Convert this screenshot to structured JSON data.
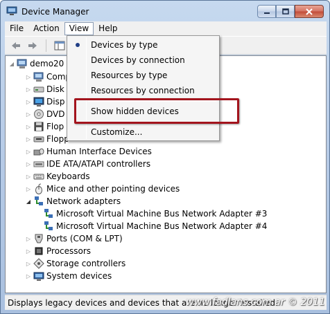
{
  "window": {
    "title": "Device Manager"
  },
  "menubar": {
    "items": [
      "File",
      "Action",
      "View",
      "Help"
    ],
    "active": "View"
  },
  "tree": {
    "root": "demo20",
    "items": [
      {
        "label": "Comp",
        "icon": "computer-icon",
        "expandable": true
      },
      {
        "label": "Disk",
        "icon": "disk-drive-icon",
        "expandable": true
      },
      {
        "label": "Disp",
        "icon": "display-adapter-icon",
        "expandable": true
      },
      {
        "label": "DVD",
        "icon": "dvd-drive-icon",
        "expandable": true
      },
      {
        "label": "Flop",
        "icon": "floppy-controller-icon",
        "expandable": true
      },
      {
        "label": "Flopp",
        "icon": "floppy-drive-icon",
        "expandable": true
      },
      {
        "label": "Human Interface Devices",
        "icon": "hid-icon",
        "expandable": true
      },
      {
        "label": "IDE ATA/ATAPI controllers",
        "icon": "ide-controller-icon",
        "expandable": true
      },
      {
        "label": "Keyboards",
        "icon": "keyboard-icon",
        "expandable": true
      },
      {
        "label": "Mice and other pointing devices",
        "icon": "mouse-icon",
        "expandable": true
      },
      {
        "label": "Network adapters",
        "icon": "network-adapter-icon",
        "expanded": true
      },
      {
        "label": "Microsoft Virtual Machine Bus Network Adapter #3",
        "icon": "network-adapter-icon",
        "child": true
      },
      {
        "label": "Microsoft Virtual Machine Bus Network Adapter #4",
        "icon": "network-adapter-icon",
        "child": true
      },
      {
        "label": "Ports (COM & LPT)",
        "icon": "port-icon",
        "expandable": true
      },
      {
        "label": "Processors",
        "icon": "processor-icon",
        "expandable": true
      },
      {
        "label": "Storage controllers",
        "icon": "storage-controller-icon",
        "expandable": true
      },
      {
        "label": "System devices",
        "icon": "system-devices-icon",
        "expandable": true
      }
    ]
  },
  "view_menu": {
    "items": [
      {
        "label": "Devices by type",
        "checked": true
      },
      {
        "label": "Devices by connection"
      },
      {
        "label": "Resources by type"
      },
      {
        "label": "Resources by connection"
      },
      {
        "label": "Show hidden devices"
      },
      {
        "label": "Customize..."
      }
    ]
  },
  "statusbar": {
    "text": "Displays legacy devices and devices that are no longer installed.",
    "watermark": "www.fadlans.com.ar © 2011"
  },
  "colors": {
    "highlight": "#a3141d",
    "accent": "#213f86"
  }
}
